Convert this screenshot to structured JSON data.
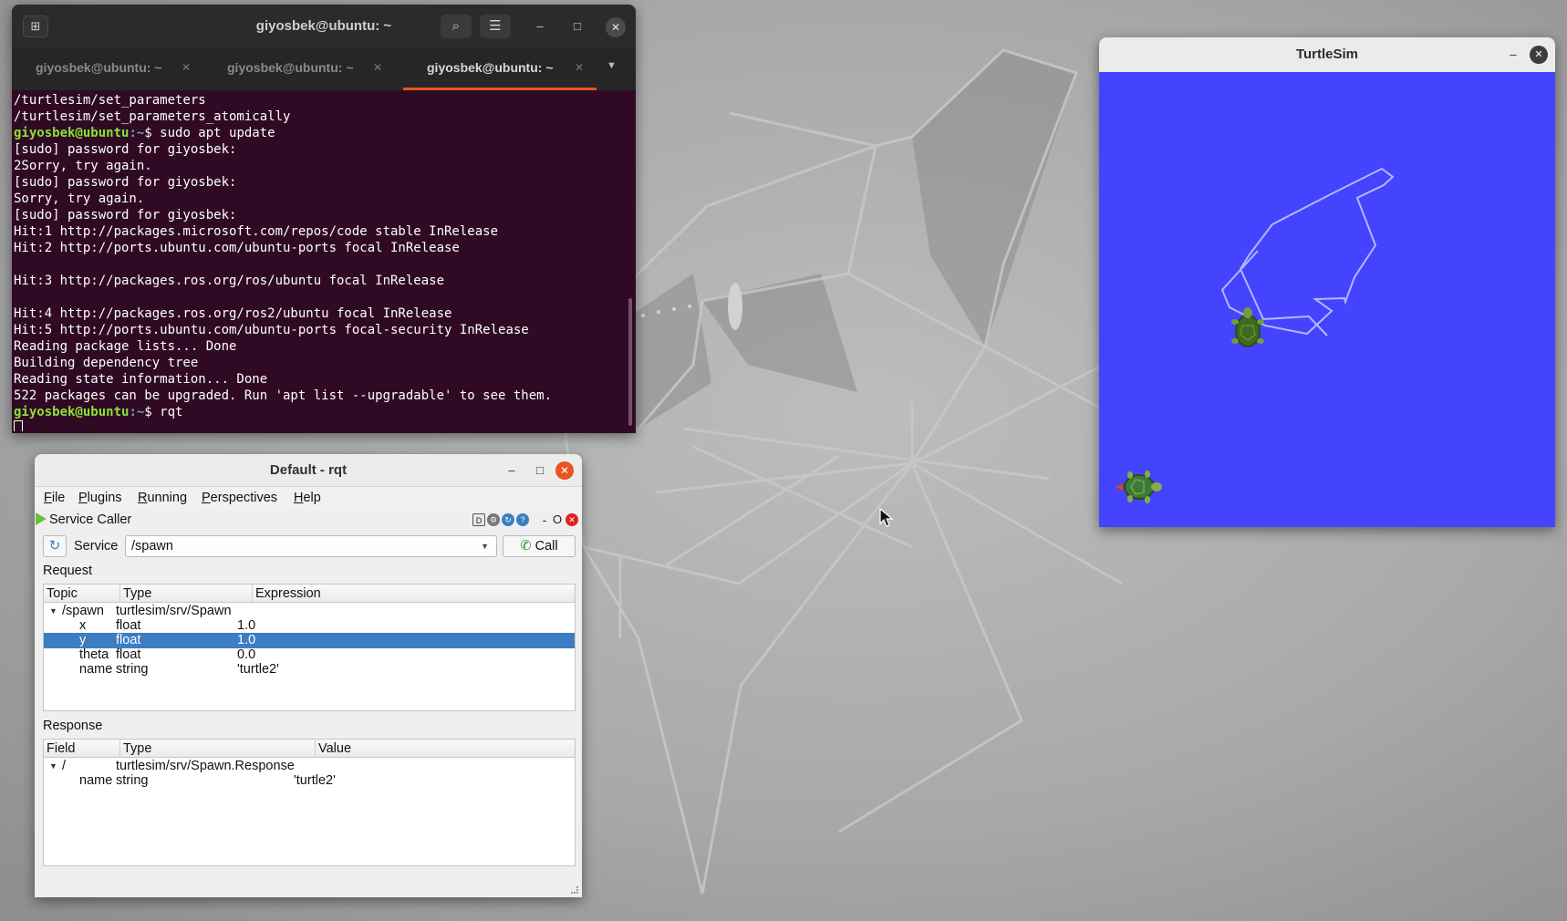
{
  "terminal": {
    "title": "giyosbek@ubuntu: ~",
    "tabs": [
      {
        "label": "giyosbek@ubuntu: ~",
        "active": false
      },
      {
        "label": "giyosbek@ubuntu: ~",
        "active": false
      },
      {
        "label": "giyosbek@ubuntu: ~",
        "active": true
      }
    ],
    "lines": [
      "/turtlesim/set_parameters",
      "/turtlesim/set_parameters_atomically",
      {
        "prompt_user": "giyosbek@ubuntu",
        "prompt_path": ":~",
        "cmd": "$ sudo apt update"
      },
      "[sudo] password for giyosbek:",
      "2Sorry, try again.",
      "[sudo] password for giyosbek:",
      "Sorry, try again.",
      "[sudo] password for giyosbek:",
      "Hit:1 http://packages.microsoft.com/repos/code stable InRelease",
      "Hit:2 http://ports.ubuntu.com/ubuntu-ports focal InRelease",
      "",
      "Hit:3 http://packages.ros.org/ros/ubuntu focal InRelease",
      "",
      "Hit:4 http://packages.ros.org/ros2/ubuntu focal InRelease",
      "Hit:5 http://ports.ubuntu.com/ubuntu-ports focal-security InRelease",
      "Reading package lists... Done",
      "Building dependency tree",
      "Reading state information... Done",
      "522 packages can be upgraded. Run 'apt list --upgradable' to see them.",
      {
        "prompt_user": "giyosbek@ubuntu",
        "prompt_path": ":~",
        "cmd": "$ rqt"
      }
    ]
  },
  "rqt": {
    "title": "Default - rqt",
    "menu": [
      {
        "label": "File",
        "ul": "F"
      },
      {
        "label": "Plugins",
        "ul": "P"
      },
      {
        "label": "Running",
        "ul": "R"
      },
      {
        "label": "Perspectives",
        "ul": "P"
      },
      {
        "label": "Help",
        "ul": "H"
      }
    ],
    "plugin_title": "Service Caller",
    "plugin_controls": {
      "d": "D",
      "minus": "-",
      "o": "O"
    },
    "service_label": "Service",
    "service_value": "/spawn",
    "call_label": "Call",
    "request_label": "Request",
    "request_columns": [
      "Topic",
      "Type",
      "Expression"
    ],
    "request_rows": [
      {
        "topic": "/spawn",
        "type": "turtlesim/srv/Spawn",
        "expr": "",
        "level": 0,
        "expanded": true,
        "selected": false
      },
      {
        "topic": "x",
        "type": "float",
        "expr": "1.0",
        "level": 1,
        "selected": false
      },
      {
        "topic": "y",
        "type": "float",
        "expr": "1.0",
        "level": 1,
        "selected": true
      },
      {
        "topic": "theta",
        "type": "float",
        "expr": "0.0",
        "level": 1,
        "selected": false
      },
      {
        "topic": "name",
        "type": "string",
        "expr": "'turtle2'",
        "level": 1,
        "selected": false
      }
    ],
    "response_label": "Response",
    "response_columns": [
      "Field",
      "Type",
      "Value"
    ],
    "response_rows": [
      {
        "field": "/",
        "type": "turtlesim/srv/Spawn.Response",
        "value": "",
        "level": 0,
        "expanded": true
      },
      {
        "field": "name",
        "type": "string",
        "value": "'turtle2'",
        "level": 1
      }
    ]
  },
  "turtlesim": {
    "title": "TurtleSim",
    "background": "#4444ff",
    "path_color": "#b3b8ff"
  },
  "colors": {
    "terminal_bg": "#300a24",
    "prompt_user": "#8ae234",
    "prompt_path": "#729fcf",
    "accent": "#e95420",
    "selection": "#3c7dc4"
  }
}
